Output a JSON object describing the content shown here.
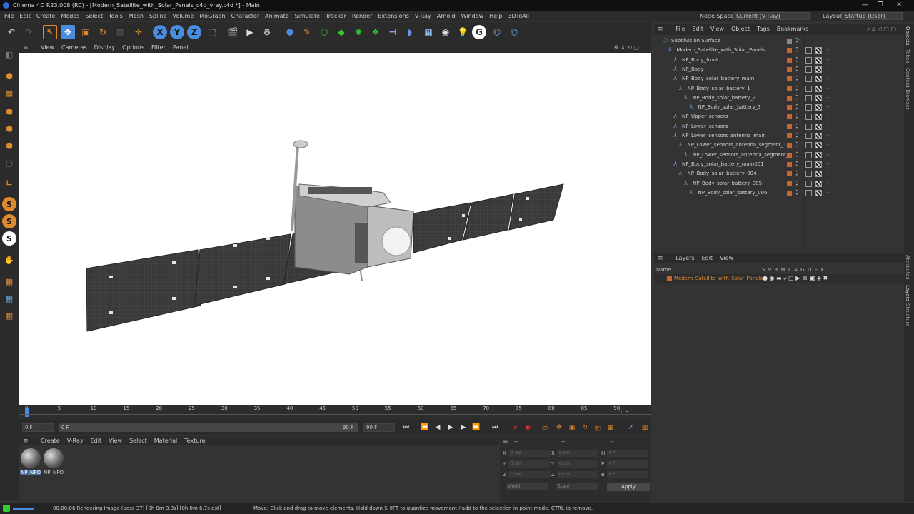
{
  "window": {
    "title": "Cinema 4D R23.008 (RC) - [Modern_Satellite_with_Solar_Panels_c4d_vray.c4d *] - Main",
    "minimize": "—",
    "maximize": "❐",
    "close": "✕"
  },
  "menu": {
    "items": [
      "File",
      "Edit",
      "Create",
      "Modes",
      "Select",
      "Tools",
      "Mesh",
      "Spline",
      "Volume",
      "MoGraph",
      "Character",
      "Animate",
      "Simulate",
      "Tracker",
      "Render",
      "Extensions",
      "V-Ray",
      "Arnold",
      "Window",
      "Help",
      "3DToAll"
    ],
    "node_space_label": "Node Space:",
    "node_space_value": "Current (V-Ray)",
    "layout_label": "Layout:",
    "layout_value": "Startup (User)"
  },
  "viewport": {
    "menu": [
      "View",
      "Cameras",
      "Display",
      "Options",
      "Filter",
      "Panel"
    ]
  },
  "timeline": {
    "ticks": [
      "0",
      "5",
      "10",
      "15",
      "20",
      "25",
      "30",
      "35",
      "40",
      "45",
      "50",
      "55",
      "60",
      "65",
      "70",
      "75",
      "80",
      "85",
      "90"
    ],
    "current_frame": "0 F"
  },
  "transport": {
    "start": "0 F",
    "range_start": "0 F",
    "range_end": "90 F",
    "end": "90 F"
  },
  "material_manager": {
    "menu": [
      "Create",
      "V-Ray",
      "Edit",
      "View",
      "Select",
      "Material",
      "Texture"
    ],
    "materials": [
      "NP_NPO",
      "NP_NPO"
    ]
  },
  "coordinates": {
    "header_left": "--",
    "header_mid": "--",
    "header_right": "--",
    "rows": [
      {
        "a": "X",
        "av": "0 cm",
        "b": "X",
        "bv": "0 cm",
        "c": "H",
        "cv": "0 °"
      },
      {
        "a": "Y",
        "av": "0 cm",
        "b": "Y",
        "bv": "0 cm",
        "c": "P",
        "cv": "0 °"
      },
      {
        "a": "Z",
        "av": "0 cm",
        "b": "Z",
        "bv": "0 cm",
        "c": "B",
        "cv": "0 °"
      }
    ],
    "mode1": "World",
    "mode2": "Scale",
    "apply": "Apply"
  },
  "status": {
    "render": "00:00:06 Rendering Image (pass 37) [0h  0m  3.8s] [0h  0m  6.7s est]",
    "hint": "Move: Click and drag to move elements. Hold down SHIFT to quantize movement / add to the selection in point mode, CTRL to remove."
  },
  "object_manager": {
    "menu": [
      "File",
      "Edit",
      "View",
      "Object",
      "Tags",
      "Bookmarks"
    ],
    "objects": [
      {
        "name": "Subdivision Surface",
        "indent": 0
      },
      {
        "name": "Modern_Satellite_with_Solar_Panels",
        "indent": 1
      },
      {
        "name": "NP_Body_front",
        "indent": 2
      },
      {
        "name": "NP_Body",
        "indent": 2
      },
      {
        "name": "NP_Body_solar_battery_main",
        "indent": 2
      },
      {
        "name": "NP_Body_solar_battery_1",
        "indent": 3
      },
      {
        "name": "NP_Body_solar_battery_2",
        "indent": 4
      },
      {
        "name": "NP_Body_solar_battery_3",
        "indent": 5
      },
      {
        "name": "NP_Upper_sensors",
        "indent": 2
      },
      {
        "name": "NP_Lower_sensors",
        "indent": 2
      },
      {
        "name": "NP_Lower_sensors_antenna_main",
        "indent": 2
      },
      {
        "name": "NP_Lower_sensors_antenna_segment_1",
        "indent": 3
      },
      {
        "name": "NP_Lower_sensors_antenna_segment_2",
        "indent": 4
      },
      {
        "name": "NP_Body_solar_battery_main001",
        "indent": 2
      },
      {
        "name": "NP_Body_solar_battery_004",
        "indent": 3
      },
      {
        "name": "NP_Body_solar_battery_005",
        "indent": 4
      },
      {
        "name": "NP_Body_solar_battery_006",
        "indent": 5
      }
    ]
  },
  "layer_manager": {
    "menu": [
      "Layers",
      "Edit",
      "View"
    ],
    "col_name": "Name",
    "flags": "S V R M L A G D E X",
    "layer": "Modern_Satellite_with_Solar_Panels"
  },
  "right_tabs": [
    "Objects",
    "Takes",
    "Content Browser",
    "Attributes",
    "Layers",
    "Structure"
  ],
  "colors": {
    "accent": "#e08a30",
    "layer_swatch": "#c8652e",
    "selection_blue": "#4a8de0"
  }
}
